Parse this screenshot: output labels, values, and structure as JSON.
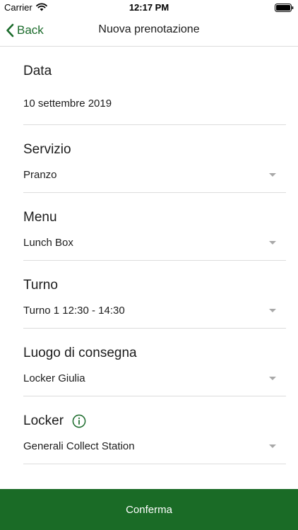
{
  "status_bar": {
    "carrier": "Carrier",
    "time": "12:17 PM"
  },
  "nav": {
    "back_label": "Back",
    "title": "Nuova prenotazione"
  },
  "form": {
    "date": {
      "label": "Data",
      "value": "10 settembre 2019"
    },
    "service": {
      "label": "Servizio",
      "value": "Pranzo"
    },
    "menu": {
      "label": "Menu",
      "value": "Lunch Box"
    },
    "shift": {
      "label": "Turno",
      "value": "Turno 1 12:30 - 14:30"
    },
    "delivery_place": {
      "label": "Luogo di consegna",
      "value": "Locker Giulia"
    },
    "locker": {
      "label": "Locker",
      "value": "Generali Collect Station"
    }
  },
  "confirm_label": "Conferma",
  "colors": {
    "accent": "#1a6b26",
    "divider": "#dcdcdc",
    "arrow": "#a8a8a8"
  },
  "icons": {
    "back": "chevron-left-icon",
    "wifi": "wifi-icon",
    "battery": "battery-icon",
    "info": "info-icon",
    "dropdown": "chevron-down-icon"
  }
}
